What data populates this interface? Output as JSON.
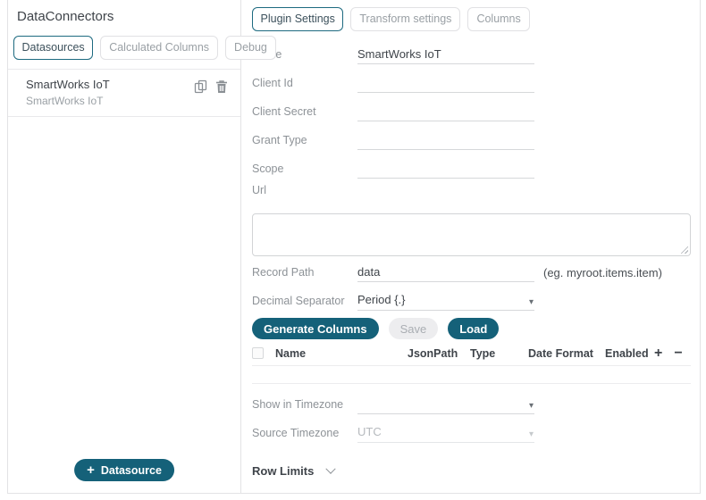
{
  "sidebar": {
    "title": "DataConnectors",
    "tabs": [
      {
        "label": "Datasources"
      },
      {
        "label": "Calculated Columns"
      },
      {
        "label": "Debug"
      }
    ],
    "item": {
      "title": "SmartWorks IoT",
      "subtitle": "SmartWorks IoT"
    },
    "add_icon": "+",
    "add_label": "Datasource"
  },
  "settings": {
    "tabs": [
      {
        "label": "Plugin Settings"
      },
      {
        "label": "Transform settings"
      },
      {
        "label": "Columns"
      }
    ],
    "fields": {
      "name": {
        "label": "Name",
        "value": "SmartWorks IoT"
      },
      "client_id": {
        "label": "Client Id",
        "value": ""
      },
      "client_secret": {
        "label": "Client Secret",
        "value": ""
      },
      "grant_type": {
        "label": "Grant Type",
        "value": ""
      },
      "scope": {
        "label": "Scope",
        "value": ""
      },
      "url": {
        "label": "Url",
        "value": ""
      },
      "record_path": {
        "label": "Record Path",
        "value": "data",
        "hint": "(eg. myroot.items.item)"
      },
      "decimal_separator": {
        "label": "Decimal Separator",
        "value": "Period {.}"
      },
      "show_in_timezone": {
        "label": "Show in Timezone",
        "value": ""
      },
      "source_timezone": {
        "label": "Source Timezone",
        "value": "UTC"
      }
    },
    "buttons": {
      "generate_columns": "Generate Columns",
      "save": "Save",
      "load": "Load"
    },
    "columns_table": {
      "headers": [
        "Name",
        "JsonPath",
        "Type",
        "Date Format",
        "Enabled"
      ],
      "add_icon": "+",
      "remove_icon": "−"
    },
    "row_limits_label": "Row Limits"
  },
  "icons": {
    "caret": "▾"
  },
  "colors": {
    "accent": "#156179",
    "active_tab_border": "#1d6a80"
  }
}
